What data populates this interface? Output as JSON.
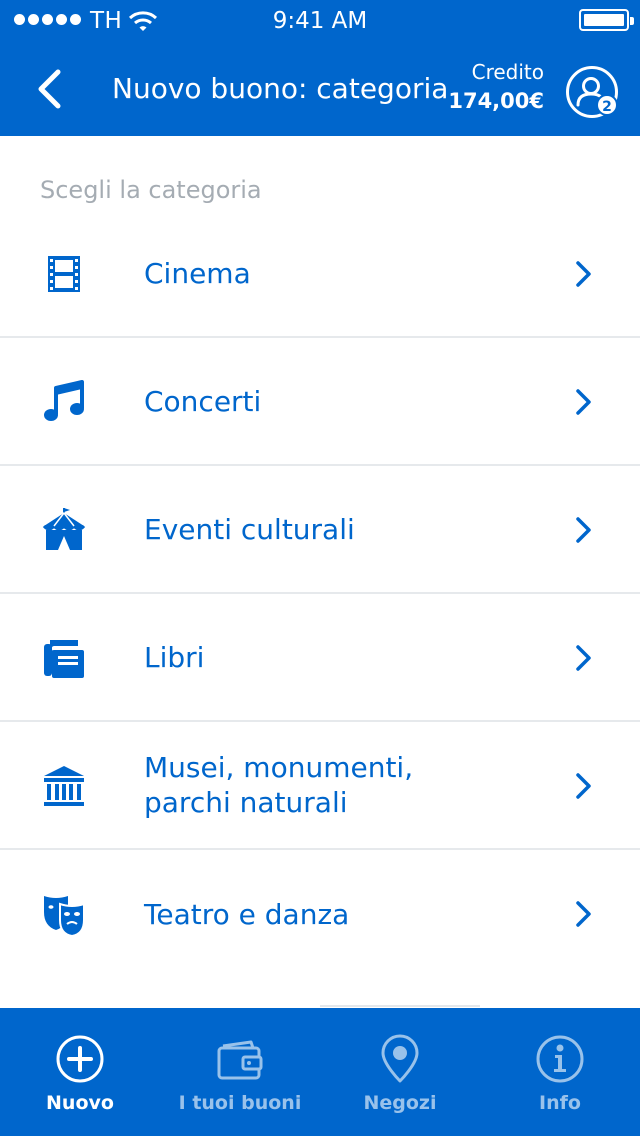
{
  "status_bar": {
    "carrier": "TH",
    "time": "9:41 AM"
  },
  "header": {
    "title": "Nuovo buono: categoria",
    "credit_label": "Credito",
    "credit_value": "174,00€",
    "profile_badge": "2"
  },
  "section_label": "Scegli la categoria",
  "categories": [
    {
      "label": "Cinema",
      "icon": "film-icon"
    },
    {
      "label": "Concerti",
      "icon": "music-note-icon"
    },
    {
      "label": "Eventi culturali",
      "icon": "circus-tent-icon"
    },
    {
      "label": "Libri",
      "icon": "books-icon"
    },
    {
      "label": "Musei, monumenti,\nparchi naturali",
      "icon": "museum-icon"
    },
    {
      "label": "Teatro e danza",
      "icon": "theater-masks-icon"
    }
  ],
  "tabs": [
    {
      "label": "Nuovo",
      "icon": "plus-circle-icon",
      "active": true
    },
    {
      "label": "I tuoi buoni",
      "icon": "wallet-icon",
      "active": false
    },
    {
      "label": "Negozi",
      "icon": "map-pin-icon",
      "active": false
    },
    {
      "label": "Info",
      "icon": "info-icon",
      "active": false
    }
  ],
  "colors": {
    "primary": "#0066cc",
    "divider": "#e6e9ec",
    "muted": "#a5acb3",
    "background": "#ffffff"
  }
}
